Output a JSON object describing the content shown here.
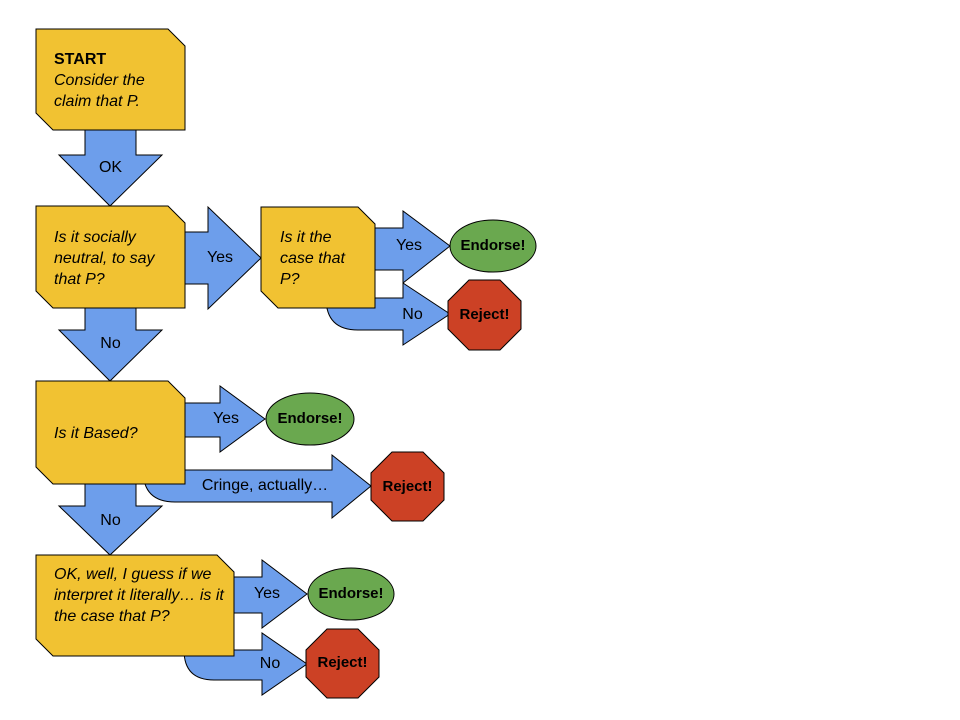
{
  "diagram": {
    "colors": {
      "question_box": "#f1c232",
      "arrow": "#6d9eeb",
      "endorse": "#6aa84f",
      "reject": "#cc4125"
    },
    "nodes": {
      "start": {
        "title": "START",
        "text": "Consider the claim that P."
      },
      "q1": {
        "text": "Is it socially neutral, to say that P?"
      },
      "q2": {
        "text": "Is it the case that P?"
      },
      "q3": {
        "text": "Is it Based?"
      },
      "q4": {
        "text": "OK, well, I guess if we interpret it literally… is it the case that P?"
      },
      "endorse": "Endorse!",
      "reject": "Reject!"
    },
    "edges": {
      "start_q1": "OK",
      "q1_q2": "Yes",
      "q1_q3": "No",
      "q2_endorse": "Yes",
      "q2_reject": "No",
      "q3_endorse": "Yes",
      "q3_reject": "Cringe, actually…",
      "q3_q4": "No",
      "q4_endorse": "Yes",
      "q4_reject": "No"
    }
  }
}
